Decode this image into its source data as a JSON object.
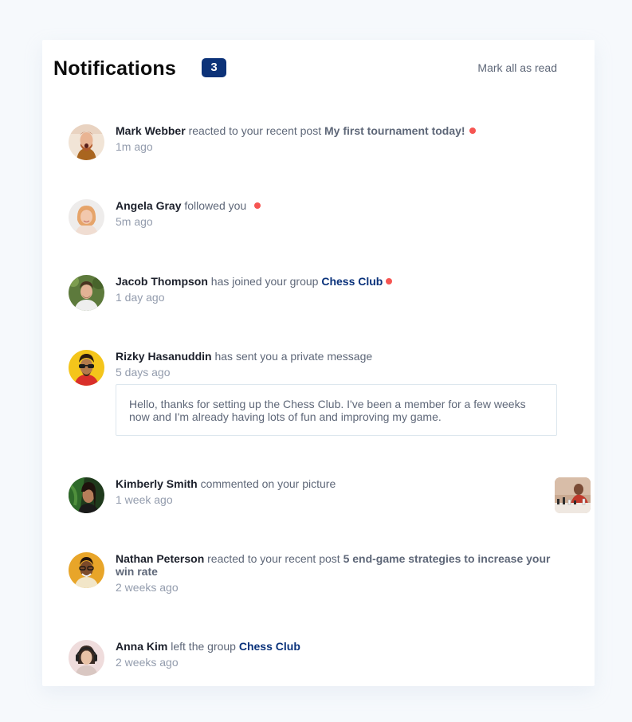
{
  "header": {
    "title": "Notifications",
    "unread_count": "3",
    "mark_all_label": "Mark all as read"
  },
  "notifications": [
    {
      "user": "Mark Webber",
      "action": "reacted to your recent post",
      "post": "My first tournament today!",
      "time": "1m ago",
      "unread": true
    },
    {
      "user": "Angela Gray",
      "action": "followed you",
      "time": "5m ago",
      "unread": true
    },
    {
      "user": "Jacob Thompson",
      "action": "has joined your group",
      "group": "Chess Club",
      "time": "1 day ago",
      "unread": true
    },
    {
      "user": "Rizky Hasanuddin",
      "action": "has sent you a private message",
      "time": "5 days ago",
      "message": "Hello, thanks for setting up the Chess Club. I've been a member for a few weeks now and I'm already having lots of fun and improving my game.",
      "unread": false
    },
    {
      "user": "Kimberly Smith",
      "action": "commented on your picture",
      "time": "1 week ago",
      "unread": false
    },
    {
      "user": "Nathan Peterson",
      "action": "reacted to your recent post",
      "post": "5 end-game strategies to increase your win rate",
      "time": "2 weeks ago",
      "unread": false
    },
    {
      "user": "Anna Kim",
      "action": "left the group",
      "group": "Chess Club",
      "time": "2 weeks ago",
      "unread": false
    }
  ],
  "colors": {
    "badge": "#0c3278",
    "unread_dot": "#f65552",
    "group_link": "#0a327b",
    "background": "#f6f9fc"
  }
}
